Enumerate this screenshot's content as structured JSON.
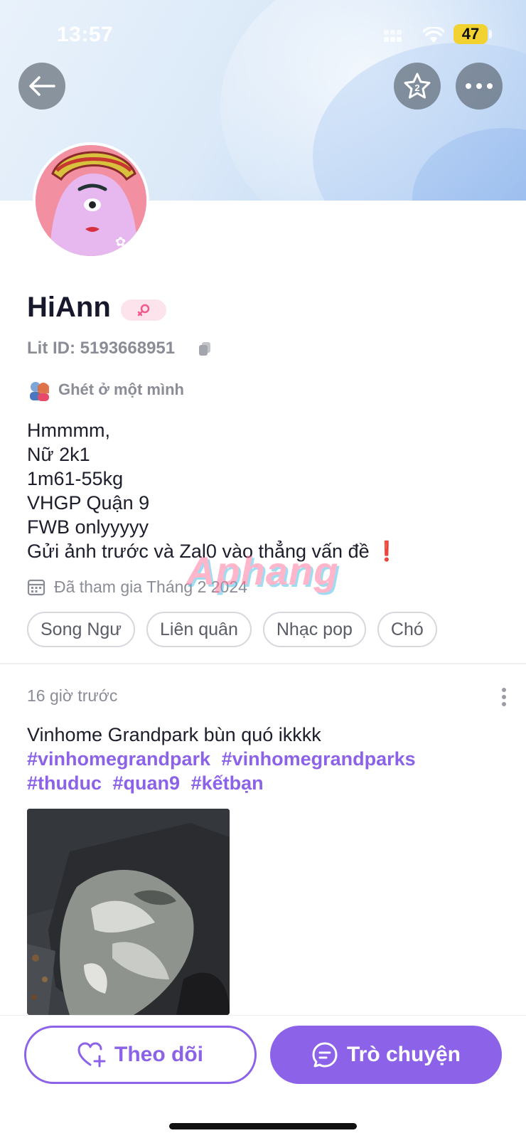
{
  "status_bar": {
    "time": "13:57",
    "battery": "47"
  },
  "header": {
    "back_icon": "arrow-left-icon",
    "favorite_icon": "star-icon",
    "more_icon": "ellipsis-icon"
  },
  "profile": {
    "name": "HiAnn",
    "gender_icon": "female-icon",
    "lit_id": "Lit ID: 5193668951",
    "mood": "Ghét ở một mình",
    "bio": [
      "Hmmmm,",
      "Nữ 2k1",
      "1m61-55kg",
      "VHGP Quận 9",
      "FWB onlyyyyy",
      "Gửi ảnh trước và Zal0 vào thẳng vấn đề"
    ],
    "bio_emoji": "❗",
    "joined": "Đã tham gia Tháng 2 2024",
    "tags": [
      "Song Ngư",
      "Liên quân",
      "Nhạc pop",
      "Chó"
    ]
  },
  "watermark": "Aphang",
  "post": {
    "time": "16 giờ trước",
    "text": "Vinhome Grandpark bùn quó ikkkk",
    "hashtags": [
      "#vinhomegrandpark",
      "#vinhomegrandparks",
      "#thuduc",
      "#quan9",
      "#kếtbạn"
    ]
  },
  "actions": {
    "follow_label": "Theo dõi",
    "chat_label": "Trò chuyện"
  },
  "colors": {
    "accent": "#8b62e8",
    "secondary_text": "#8a8c96",
    "battery": "#f1d230"
  }
}
